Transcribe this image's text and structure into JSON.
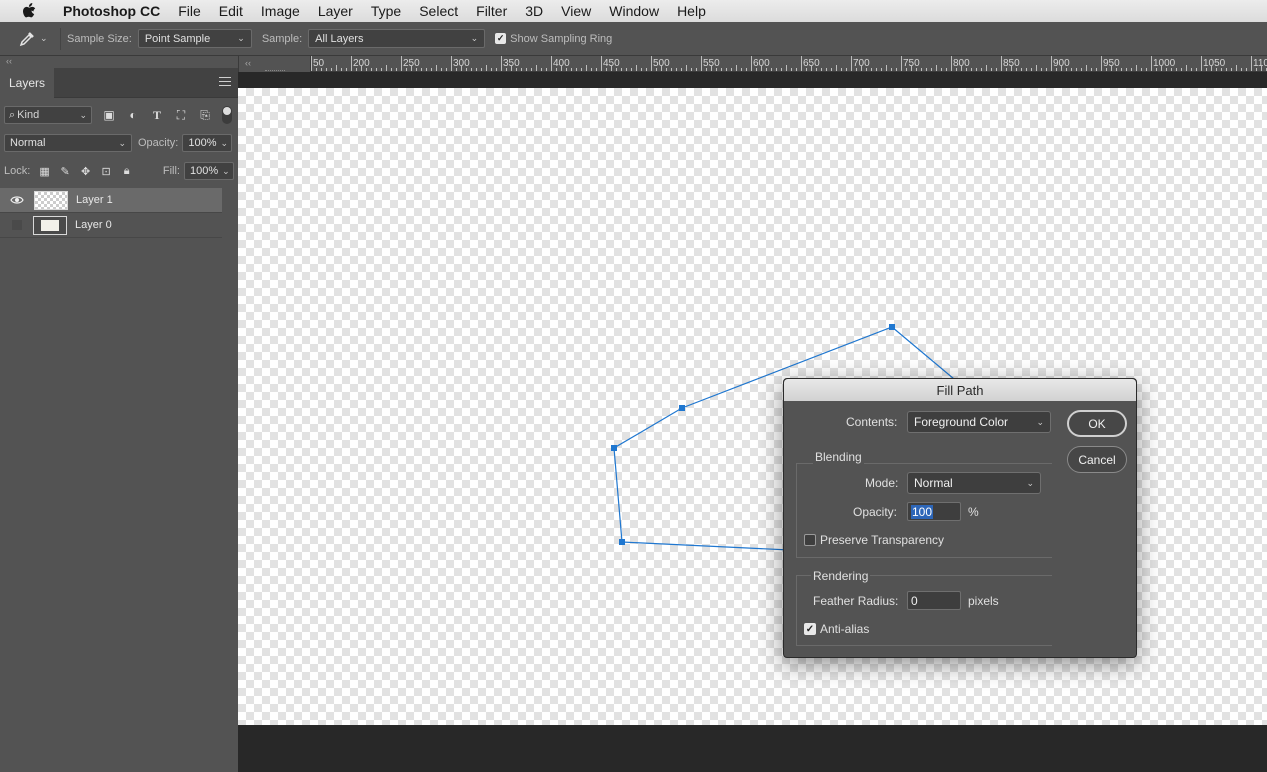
{
  "menubar": {
    "apple_icon": "apple-icon",
    "items": [
      "Photoshop CC",
      "File",
      "Edit",
      "Image",
      "Layer",
      "Type",
      "Select",
      "Filter",
      "3D",
      "View",
      "Window",
      "Help"
    ]
  },
  "options_bar": {
    "tool_icon": "eyedropper-icon",
    "sample_size_label": "Sample Size:",
    "sample_size_value": "Point Sample",
    "sample_label": "Sample:",
    "sample_value": "All Layers",
    "show_ring_label": "Show Sampling Ring",
    "show_ring_checked": true
  },
  "layers_panel": {
    "tab": "Layers",
    "filter_kind": "Kind",
    "blend_mode": "Normal",
    "opacity_label": "Opacity:",
    "opacity_value": "100%",
    "lock_label": "Lock:",
    "fill_label": "Fill:",
    "fill_value": "100%",
    "layers": [
      {
        "name": "Layer 1",
        "visible": true,
        "selected": true
      },
      {
        "name": "Layer 0",
        "visible": false,
        "selected": false
      }
    ]
  },
  "tools": {
    "more_label": "•••"
  },
  "ruler": {
    "labels": [
      "50",
      "200",
      "250",
      "300",
      "350",
      "400",
      "450",
      "500",
      "550",
      "600",
      "650",
      "700",
      "750",
      "800",
      "850",
      "900",
      "950",
      "1000",
      "1050",
      "110"
    ]
  },
  "dialog": {
    "title": "Fill Path",
    "contents_label": "Contents:",
    "contents_value": "Foreground Color",
    "ok": "OK",
    "cancel": "Cancel",
    "blending_header": "Blending",
    "mode_label": "Mode:",
    "mode_value": "Normal",
    "opacity_label": "Opacity:",
    "opacity_value": "100",
    "opacity_unit": "%",
    "preserve_label": "Preserve Transparency",
    "preserve_checked": false,
    "rendering_header": "Rendering",
    "feather_label": "Feather Radius:",
    "feather_value": "0",
    "feather_unit": "pixels",
    "antialias_label": "Anti-alias",
    "antialias_checked": true
  },
  "colors": {
    "path_stroke": "#1f77d0",
    "foreground": "#f3f1ea",
    "background": "#ecebe2"
  }
}
